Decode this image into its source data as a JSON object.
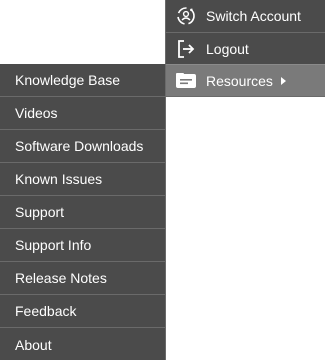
{
  "account_menu": {
    "items": [
      {
        "label": "Switch Account",
        "icon": "switch-account-icon"
      },
      {
        "label": "Logout",
        "icon": "logout-icon"
      },
      {
        "label": "Resources",
        "icon": "resources-icon"
      }
    ]
  },
  "resources_menu": {
    "items": [
      {
        "label": "Knowledge Base"
      },
      {
        "label": "Videos"
      },
      {
        "label": "Software Downloads"
      },
      {
        "label": "Known Issues"
      },
      {
        "label": "Support"
      },
      {
        "label": "Support Info"
      },
      {
        "label": "Release Notes"
      },
      {
        "label": "Feedback"
      },
      {
        "label": "About"
      }
    ]
  },
  "colors": {
    "menu_bg": "#4b4b4b",
    "highlight_bg": "#7a7a7a",
    "text": "#ffffff"
  }
}
